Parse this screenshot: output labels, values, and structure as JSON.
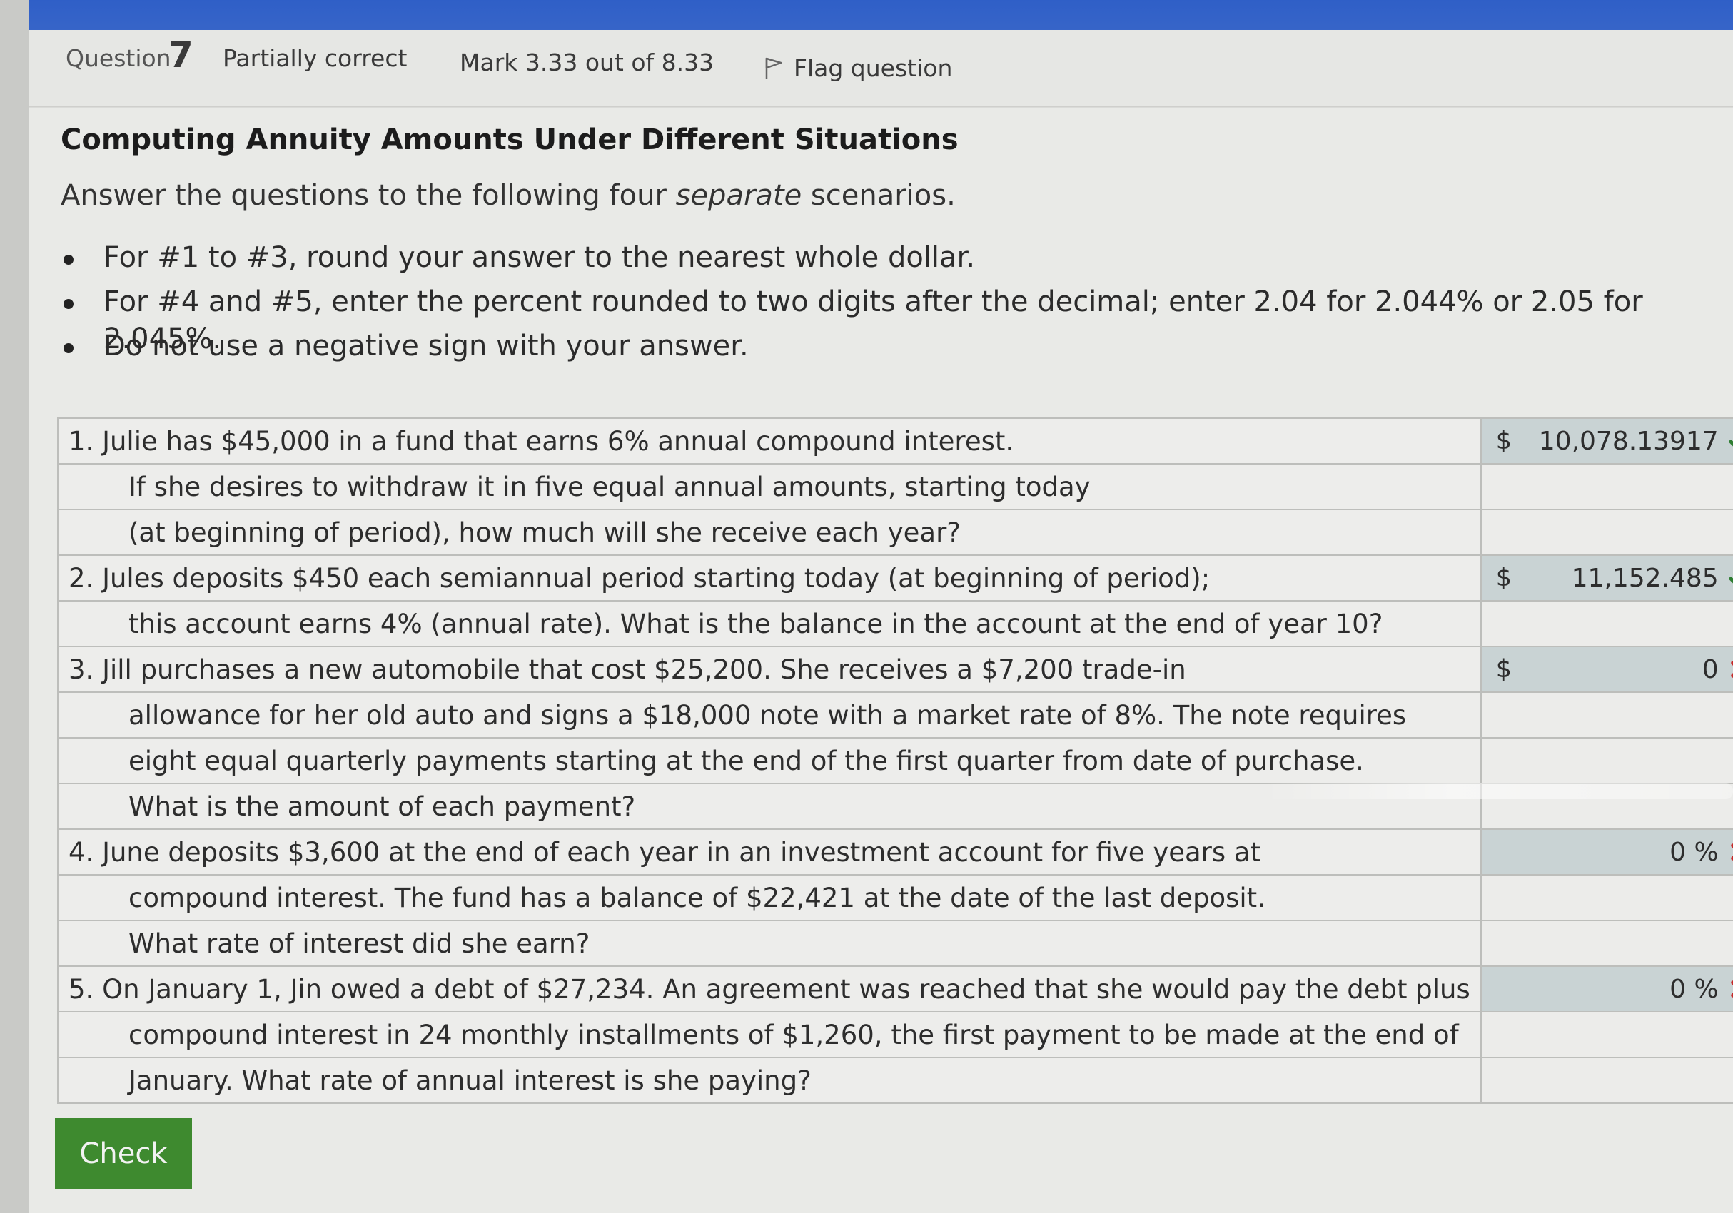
{
  "header": {
    "question_label": "Question",
    "question_number": "7",
    "state": "Partially correct",
    "mark": "Mark 3.33 out of 8.33",
    "flag_label": "Flag question"
  },
  "question": {
    "title": "Computing Annuity Amounts Under Different Situations",
    "intro_before": "Answer the questions to the following four ",
    "intro_emphasis": "separate",
    "intro_after": " scenarios.",
    "bullets": [
      "For #1 to #3, round your answer to the nearest whole dollar.",
      "For #4 and #5, enter the percent rounded to two digits after the decimal; enter 2.04 for 2.044% or 2.05 for 2.045%.",
      "Do not use a negative sign with your answer."
    ]
  },
  "table": {
    "rows": [
      {
        "text": "1. Julie has $45,000 in a fund that earns 6% annual compound interest.",
        "prefix": "$",
        "answer": "10,078.13917",
        "result": "correct"
      },
      {
        "text": "If she desires to withdraw it in five equal annual amounts, starting today"
      },
      {
        "text": "(at beginning of period), how much will she receive each year?"
      },
      {
        "text": "2. Jules deposits $450 each semiannual period starting today (at beginning of period);",
        "prefix": "$",
        "answer": "11,152.485",
        "result": "correct"
      },
      {
        "text": "this account earns 4% (annual rate). What is the balance in the account at the end of year 10?"
      },
      {
        "text": "3. Jill purchases a new automobile that cost $25,200. She receives a $7,200 trade-in",
        "prefix": "$",
        "answer": "0",
        "result": "incorrect"
      },
      {
        "text": "allowance for her old auto and signs a $18,000 note with a market rate of 8%. The note requires"
      },
      {
        "text": "eight equal quarterly payments starting at the end of the first quarter from date of purchase."
      },
      {
        "text": "What is the amount of each payment?"
      },
      {
        "text": "4. June deposits $3,600 at the end of each year in an investment account for five years at",
        "prefix": "",
        "answer": "0 %",
        "result": "incorrect"
      },
      {
        "text": "compound interest. The fund has a balance of $22,421 at the date of the last deposit."
      },
      {
        "text": "What rate of interest did she earn?"
      },
      {
        "text": "5. On January 1, Jin owed a debt of $27,234. An agreement was reached that she would pay the debt plus",
        "prefix": "",
        "answer": "0 %",
        "result": "incorrect"
      },
      {
        "text": "compound interest in 24 monthly installments of $1,260, the first payment to be made at the end of"
      },
      {
        "text": "January. What rate of annual interest is she paying?"
      }
    ]
  },
  "check_button_label": "Check",
  "colors": {
    "correct": "#2e7d32",
    "incorrect": "#c62828",
    "check_button": "#3e8a2f",
    "top_bar": "#2f5fc7"
  }
}
